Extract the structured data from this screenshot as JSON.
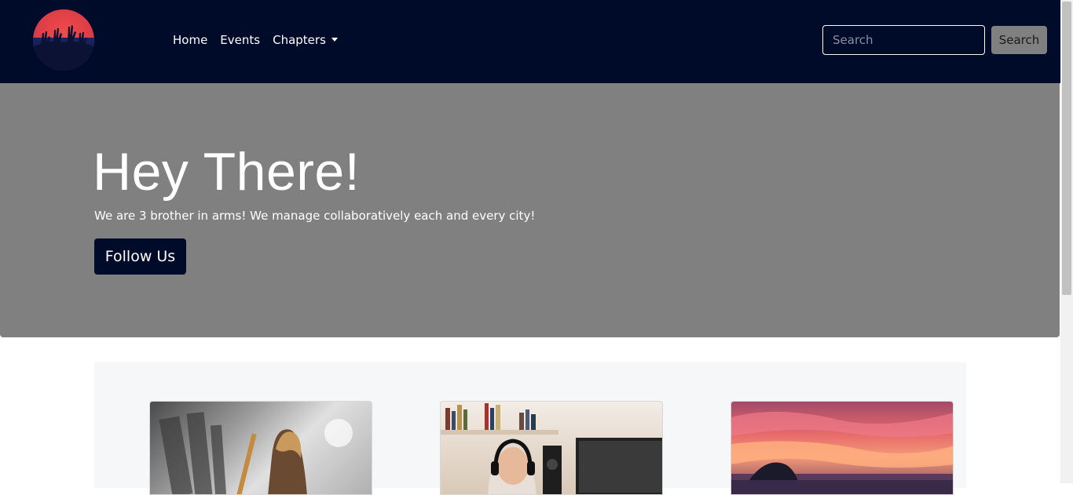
{
  "nav": {
    "links": [
      {
        "label": "Home"
      },
      {
        "label": "Events"
      },
      {
        "label": "Chapters"
      }
    ],
    "search": {
      "placeholder": "Search",
      "button_label": "Search"
    }
  },
  "hero": {
    "title": "Hey There!",
    "subtitle": "We are 3 brother in arms! We manage collaboratively each and every city!",
    "button_label": "Follow Us"
  },
  "colors": {
    "navbar_bg": "#000b2a",
    "hero_bg": "#808080",
    "section_bg": "#f6f7f9",
    "accent": "#ef4c4c"
  },
  "cards": [
    {
      "image": "concert-guitarist-photo"
    },
    {
      "image": "woman-headphones-recording-photo"
    },
    {
      "image": "sunset-seascape-photo"
    }
  ]
}
